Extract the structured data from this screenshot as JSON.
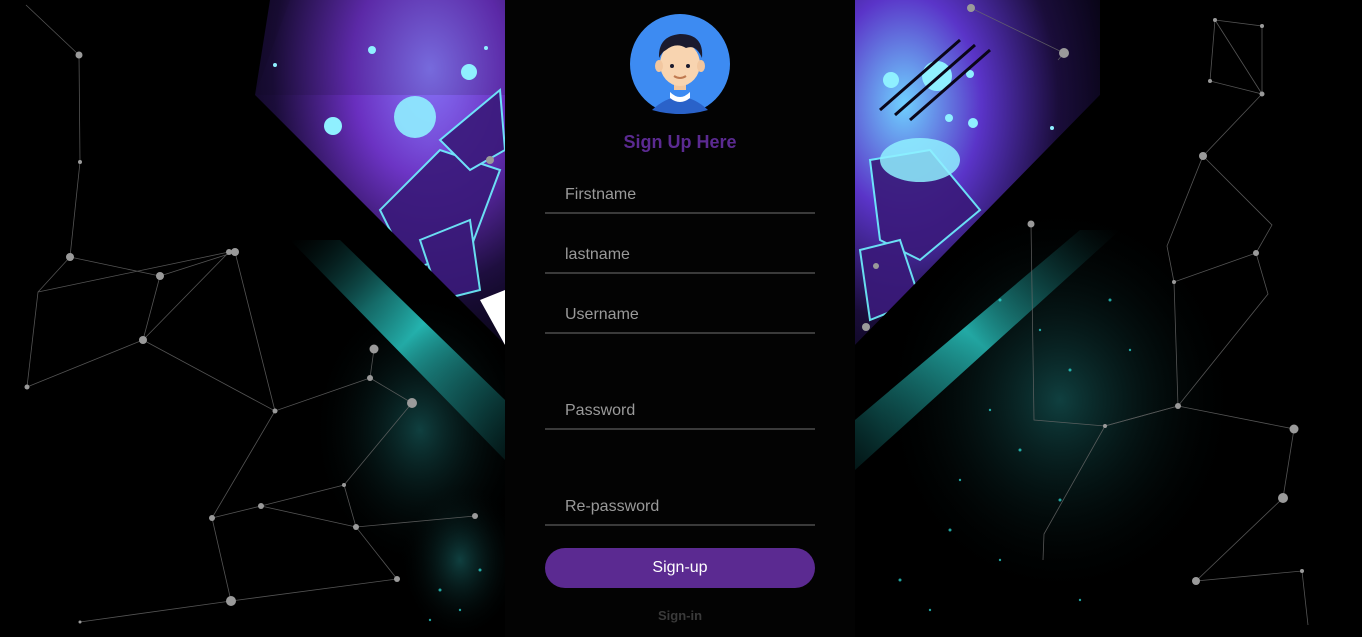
{
  "form": {
    "title": "Sign Up Here",
    "fields": {
      "firstname_placeholder": "Firstname",
      "lastname_placeholder": "lastname",
      "username_placeholder": "Username",
      "password_placeholder": "Password",
      "repassword_placeholder": "Re-password"
    },
    "submit_label": "Sign-up",
    "signin_label": "Sign-in"
  },
  "avatar": {
    "icon": "user-avatar-icon"
  },
  "colors": {
    "accent": "#5b2a91",
    "background": "#000000",
    "avatar_bg": "#3d8bf2",
    "cyan_glow": "#2ee6e0",
    "violet_glow": "#7a3fd0"
  }
}
